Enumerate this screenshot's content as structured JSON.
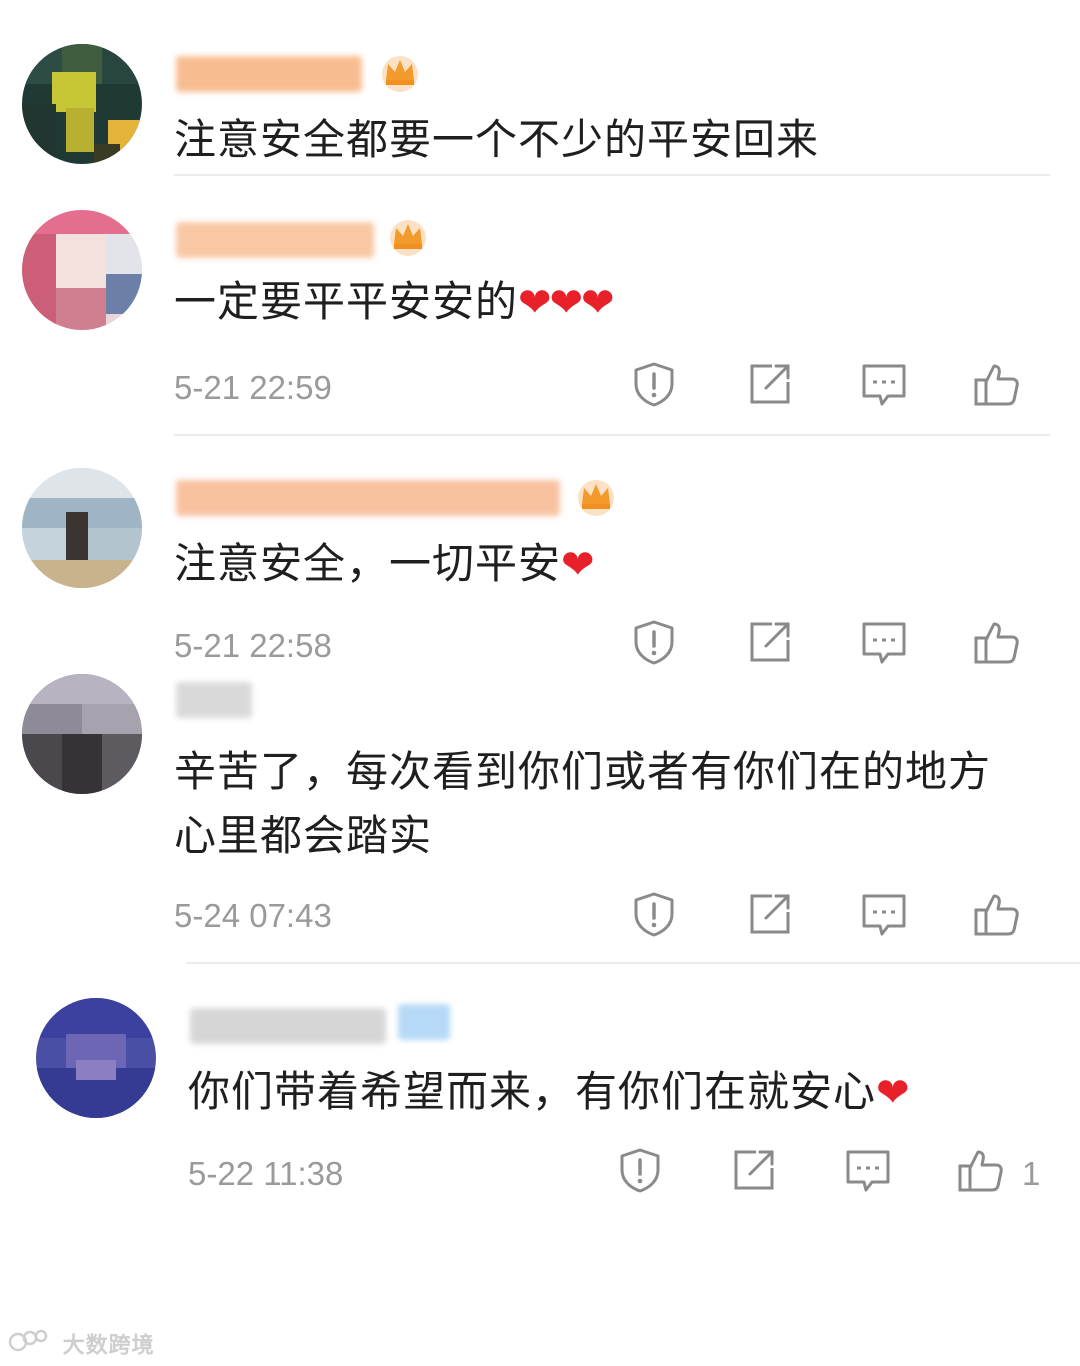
{
  "comments": [
    {
      "text": "注意安全都要一个不少的平安回来",
      "hearts": "",
      "time": "",
      "likes": ""
    },
    {
      "text": "一定要平平安安的",
      "hearts": "❤❤❤",
      "time": "5-21 22:59",
      "likes": ""
    },
    {
      "text": "注意安全，一切平安",
      "hearts": "❤",
      "time": "5-21 22:58",
      "likes": ""
    },
    {
      "text_line1": "辛苦了，每次看到你们或者有你们在的地方",
      "text_line2": "心里都会踏实",
      "time": "5-24 07:43",
      "likes": ""
    },
    {
      "text": "你们带着希望而来，有你们在就安心",
      "hearts": "❤",
      "time": "5-22 11:38",
      "likes": "1"
    }
  ],
  "icons": {
    "report": "shield-exclamation-icon",
    "share": "share-square-icon",
    "reply": "comment-bubble-icon",
    "like": "thumbs-up-icon",
    "vip": "crown-icon"
  },
  "colors": {
    "text": "#1f1f1f",
    "meta": "#9a9a9a",
    "heart": "#e8202a",
    "username_blur": "#f4a574",
    "crown": "#f39a2c",
    "divider": "#ececec"
  },
  "watermark": {
    "text": "大数跨境"
  }
}
